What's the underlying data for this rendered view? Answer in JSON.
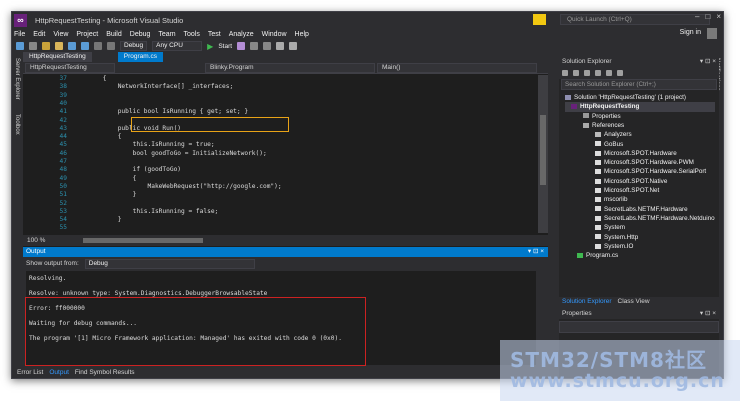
{
  "window": {
    "title": "HttpRequestTesting - Microsoft Visual Studio",
    "quick_launch_placeholder": "Quick Launch (Ctrl+Q)",
    "sign_in": "Sign in"
  },
  "menu": [
    "File",
    "Edit",
    "View",
    "Project",
    "Build",
    "Debug",
    "Team",
    "Tools",
    "Test",
    "Analyze",
    "Window",
    "Help"
  ],
  "toolbar": {
    "config": "Debug",
    "platform": "Any CPU",
    "start": "Start"
  },
  "side_strip": {
    "server_explorer": "Server Explorer",
    "toolbox": "Toolbox",
    "notifications": "Notifications"
  },
  "editor": {
    "tabs": [
      "HttpRequestTesting",
      "Program.cs"
    ],
    "nav": {
      "project": "HttpRequestTesting",
      "class": "Blinky.Program",
      "member": "Main()"
    },
    "zoom": "100 %",
    "lines": [
      {
        "n": "37",
        "text": "        {"
      },
      {
        "n": "38",
        "text": "            NetworkInterface[] _interfaces;"
      },
      {
        "n": "39",
        "text": ""
      },
      {
        "n": "40",
        "text": ""
      },
      {
        "n": "41",
        "text": "            public bool IsRunning { get; set; }"
      },
      {
        "n": "42",
        "text": ""
      },
      {
        "n": "43",
        "text": "            public void Run()"
      },
      {
        "n": "44",
        "text": "            {"
      },
      {
        "n": "45",
        "text": "                this.IsRunning = true;"
      },
      {
        "n": "46",
        "text": "                bool goodToGo = InitializeNetwork();"
      },
      {
        "n": "47",
        "text": ""
      },
      {
        "n": "48",
        "text": "                if (goodToGo)"
      },
      {
        "n": "49",
        "text": "                {"
      },
      {
        "n": "50",
        "text": "                    MakeWebRequest(\"http://google.com\");"
      },
      {
        "n": "51",
        "text": "                }"
      },
      {
        "n": "52",
        "text": ""
      },
      {
        "n": "53",
        "text": "                this.IsRunning = false;"
      },
      {
        "n": "54",
        "text": "            }"
      },
      {
        "n": "55",
        "text": ""
      }
    ]
  },
  "output": {
    "title": "Output",
    "show_from_label": "Show output from:",
    "show_from_value": "Debug",
    "lines": [
      "Resolving.",
      "",
      "Resolve: unknown type: System.Diagnostics.DebuggerBrowsableState",
      "",
      "Error: ff000000",
      "",
      "Waiting for debug commands...",
      "",
      "The program '[1] Micro Framework application: Managed' has exited with code 0 (0x0)."
    ]
  },
  "bottom_tabs": [
    "Error List",
    "Output",
    "Find Symbol Results"
  ],
  "solution_explorer": {
    "title": "Solution Explorer",
    "search_placeholder": "Search Solution Explorer (Ctrl+;)",
    "tree": [
      {
        "label": "Solution 'HttpRequestTesting' (1 project)",
        "indent": 0
      },
      {
        "label": "HttpRequestTesting",
        "indent": 1
      },
      {
        "label": "Properties",
        "indent": 2
      },
      {
        "label": "References",
        "indent": 2
      },
      {
        "label": "Analyzers",
        "indent": 3
      },
      {
        "label": "GoBus",
        "indent": 3
      },
      {
        "label": "Microsoft.SPOT.Hardware",
        "indent": 3
      },
      {
        "label": "Microsoft.SPOT.Hardware.PWM",
        "indent": 3
      },
      {
        "label": "Microsoft.SPOT.Hardware.SerialPort",
        "indent": 3
      },
      {
        "label": "Microsoft.SPOT.Native",
        "indent": 3
      },
      {
        "label": "Microsoft.SPOT.Net",
        "indent": 3
      },
      {
        "label": "mscorlib",
        "indent": 3
      },
      {
        "label": "SecretLabs.NETMF.Hardware",
        "indent": 3
      },
      {
        "label": "SecretLabs.NETMF.Hardware.Netduino",
        "indent": 3
      },
      {
        "label": "System",
        "indent": 3
      },
      {
        "label": "System.Http",
        "indent": 3
      },
      {
        "label": "System.IO",
        "indent": 3
      },
      {
        "label": "Program.cs",
        "indent": 2
      }
    ],
    "tabs": [
      "Solution Explorer",
      "Class View"
    ]
  },
  "properties": {
    "title": "Properties"
  },
  "watermark": {
    "line1": "STM32/STM8社区",
    "line2": "www.stmcu.org.cn"
  }
}
